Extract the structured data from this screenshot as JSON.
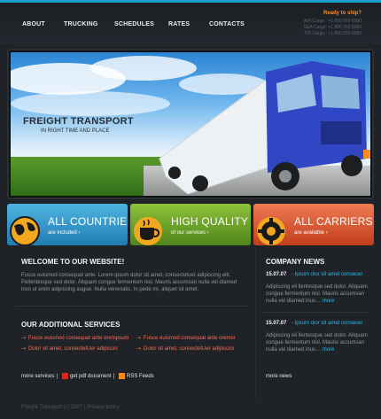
{
  "nav": {
    "items": [
      "ABOUT",
      "TRUCKING",
      "SCHEDULES",
      "RATES",
      "CONTACTS"
    ]
  },
  "ship": {
    "title": "Ready to ship?",
    "rows": [
      "AIR Cargo : +1 800 559 6580",
      "SEA Cargo: +1 800 559 6580",
      "TIR Cargo : +1 800 559 6580"
    ]
  },
  "hero": {
    "title": "FREIGHT TRANSPORT",
    "subtitle": "IN RIGHT TIME AND PLACE"
  },
  "banners": [
    {
      "title": "ALL COUNTRIES",
      "sub": "are included ›",
      "color": "#2f95c9",
      "icon": "globe-icon"
    },
    {
      "title": "HIGH QUALITY",
      "sub": "of our services ›",
      "color": "#71a52c",
      "icon": "cup-icon"
    },
    {
      "title": "ALL CARRIERS",
      "sub": "are available ›",
      "color": "#d9502b",
      "icon": "gear-icon"
    }
  ],
  "welcome": {
    "title": "WELCOME TO OUR WEBSITE!",
    "text": "Fusce euismod consequat ante. Lorem ipsum dolor sit amet, consectetuer adipiscing elit. Pellentesque sed dolor. Aliquam congue fermentum nisl. Mauris accumsan nulla vel diamed inus ut enim adipiscing augue. Nulla venenatis. In pede mi, aliquet sit amet."
  },
  "services": {
    "title": "OUR ADDITIONAL SERVICES",
    "left": [
      "Fusce euismod consequat ante orempsum",
      "Dolor sit amet, consectetUer adipiscin"
    ],
    "right": [
      "Fusce euismod consequat ante oremsi",
      "Dolor sit amet, consectetUer adipiscini"
    ]
  },
  "footer_links": {
    "more": "more services",
    "pdf": "get pdf document",
    "rss": "RSS Feeds",
    "news": "more news"
  },
  "news": {
    "title": "COMPANY NEWS",
    "items": [
      {
        "date": "15.07.07",
        "link": "- Ipsum olor sit amet consecer",
        "text": "Adipiscing eli llentesque sed dolor. Aliquam congue fermentum nisl. Mauris accumsan nulla vel diamed inus…",
        "more": "more"
      },
      {
        "date": "15.07.07",
        "link": "- Ipsum olor sit amet consecer",
        "text": "Adipiscing eli llentesque sed dolor. Aliquam congue fermentum nisl. Mauris accumsan nulla vel diamed inus…",
        "more": "more"
      }
    ]
  },
  "copyright": "Freight Transport (c) 2007 | Privacy policy",
  "colors": {
    "accent": "#1a9dc6",
    "orange": "#ff8a1e",
    "link": "#2fb6e5",
    "service": "#ff6a4d"
  }
}
